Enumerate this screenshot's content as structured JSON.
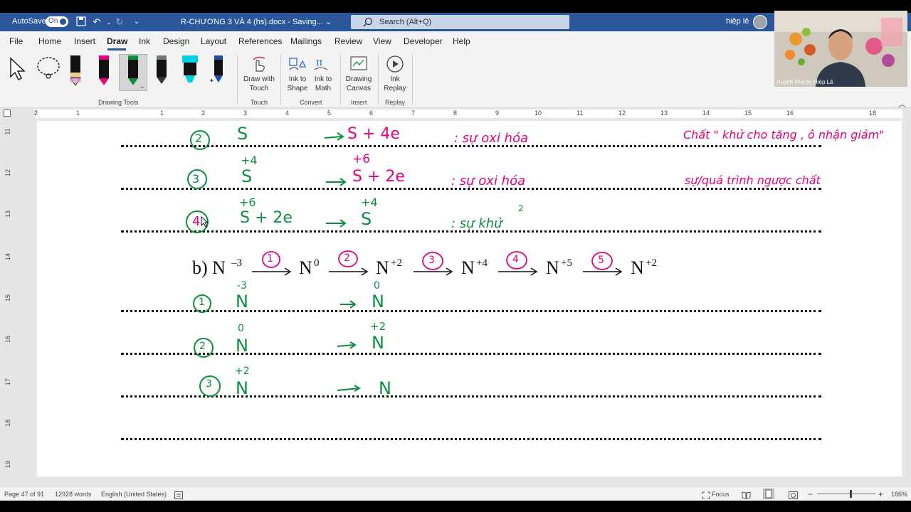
{
  "titlebar": {
    "autosave_label": "AutoSave",
    "autosave_state": "On",
    "doc_title": "R-CHƯƠNG 3 VÀ 4 (hs).docx  -  Saving...  ⌄",
    "search_placeholder": "Search (Alt+Q)",
    "user_name": "hiệp lê"
  },
  "tabs": [
    "File",
    "Home",
    "Insert",
    "Draw",
    "Ink",
    "Design",
    "Layout",
    "References",
    "Mailings",
    "Review",
    "View",
    "Developer",
    "Help"
  ],
  "active_tab": "Draw",
  "ribbon": {
    "group_drawing_tools": "Drawing Tools",
    "group_touch": "Touch",
    "group_convert": "Convert",
    "group_insert": "Insert",
    "group_replay": "Replay",
    "btn_draw_touch_1": "Draw with",
    "btn_draw_touch_2": "Touch",
    "btn_ink_shape_1": "Ink to",
    "btn_ink_shape_2": "Shape",
    "btn_ink_math_1": "Ink to",
    "btn_ink_math_2": "Math",
    "btn_canvas_1": "Drawing",
    "btn_canvas_2": "Canvas",
    "btn_replay_1": "Ink",
    "btn_replay_2": "Replay",
    "pen_colors": [
      "#111111",
      "#e6007e",
      "#0a8f3c",
      "#333333",
      "#00d0e0",
      "#1c4ea8"
    ]
  },
  "ruler_numbers": [
    "2",
    "1",
    "1",
    "2",
    "3",
    "4",
    "5",
    "6",
    "7",
    "8",
    "9",
    "10",
    "11",
    "12",
    "13",
    "14",
    "15",
    "16",
    "18"
  ],
  "vruler_numbers": [
    "11",
    "12",
    "13",
    "14",
    "15",
    "16",
    "17",
    "18",
    "19"
  ],
  "document": {
    "row1": {
      "num": "2",
      "left": "S",
      "right": "S + 4e",
      "desc": ": sự oxi hóa",
      "note": "Chất \" khử cho tăng , ô nhận giảm\""
    },
    "row2": {
      "num": "3",
      "left_ox": "+4",
      "left": "S",
      "right_ox": "+6",
      "right": "S + 2e",
      "desc": ": sự oxi hóa",
      "note": "sự/quá trình  ngược chất"
    },
    "row3": {
      "num": "4",
      "left_ox": "+6",
      "left": "S + 2e",
      "right_ox": "+4",
      "right": "S",
      "desc": ": sự khử",
      "desc_sup": "2"
    },
    "chain": {
      "prefix": "b) N",
      "first_sup": "–3",
      "steps": [
        {
          "circle": "1",
          "species": "N",
          "sup": "0"
        },
        {
          "circle": "2",
          "species": "N",
          "sup": "+2"
        },
        {
          "circle": "3",
          "species": "N",
          "sup": "+4"
        },
        {
          "circle": "4",
          "species": "N",
          "sup": "+5"
        },
        {
          "circle": "5",
          "species": "N",
          "sup": "+2"
        }
      ]
    },
    "nrow1": {
      "num": "1",
      "left_ox": "-3",
      "left": "N",
      "right_ox": "0",
      "right": "N"
    },
    "nrow2": {
      "num": "2",
      "left_ox": "0",
      "left": "N",
      "right_ox": "+2",
      "right": "N"
    },
    "nrow3": {
      "num": "3",
      "left_ox": "+2",
      "left": "N",
      "right": "N"
    }
  },
  "status": {
    "page": "Page 47 of 91",
    "words": "12928 words",
    "language": "English (United States)",
    "focus": "Focus",
    "zoom": "186%"
  },
  "webcam": {
    "name": "Huỳnh Phước Hiệp Lê"
  },
  "colors": {
    "title_blue": "#2b579a",
    "ink_green": "#0a8f3c",
    "ink_pink": "#e6007e"
  }
}
